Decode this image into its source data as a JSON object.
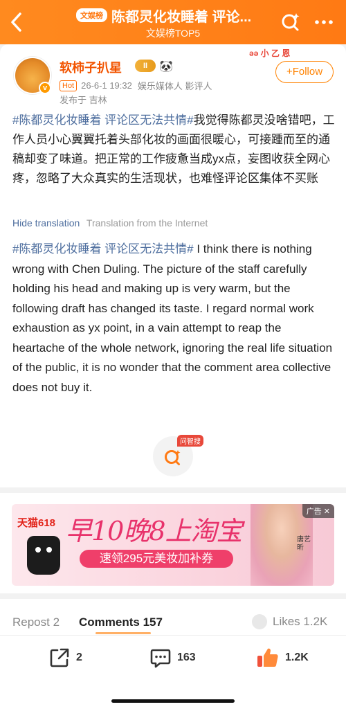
{
  "header": {
    "badge": "文娱榜",
    "title": "陈都灵化妆睡着 评论...",
    "subtitle": "文娱榜TOP5",
    "colors": {
      "bg": "#ff7a14",
      "text": "#ffffff"
    }
  },
  "post": {
    "username": "软柿子扒星",
    "vip_label": "II",
    "panda": "🐼",
    "hot": "Hot",
    "timestamp": "26-6-1 19:32",
    "tags": "娱乐媒体人 影评人",
    "published": "发布于 吉林",
    "follow_label": "+Follow",
    "deco_text": "ǝǝ 小 乙 恩",
    "content_zh_tag": "#陈都灵化妆睡着 评论区无法共情#",
    "content_zh_body": "我觉得陈都灵没啥错吧，工作人员小心翼翼托着头部化妆的画面很暖心，可接踵而至的通稿却变了味道。把正常的工作疲惫当成yx点，妄图收获全网心疼，忽略了大众真实的生活现状，也难怪评论区集体不买账",
    "hide_translation": "Hide translation",
    "translation_source": "Translation from the Internet",
    "content_en_tag": "#陈都灵化妆睡着 评论区无法共情#",
    "content_en_body": " I think there is nothing wrong with Chen Duling. The picture of the staff carefully holding his head and making up is very warm, but the following draft has changed its taste. I regard normal work exhaustion as yx point, in a vain attempt to reap the heartache of the whole network, ignoring the real life situation of the public, it is no wonder that the comment area collective does not buy it.",
    "wenzhi_label": "问智搜"
  },
  "ad": {
    "brand": "天猫618",
    "headline": "早10晚8上淘宝",
    "cta": "速领295元美妆加补券",
    "person_name": "唐艺昕",
    "label": "广告 ✕"
  },
  "tabs": {
    "repost": "Repost 2",
    "comments": "Comments 157",
    "likes": "Likes 1.2K"
  },
  "bottom_bar": {
    "share_count": "2",
    "comment_count": "163",
    "like_count": "1.2K"
  }
}
